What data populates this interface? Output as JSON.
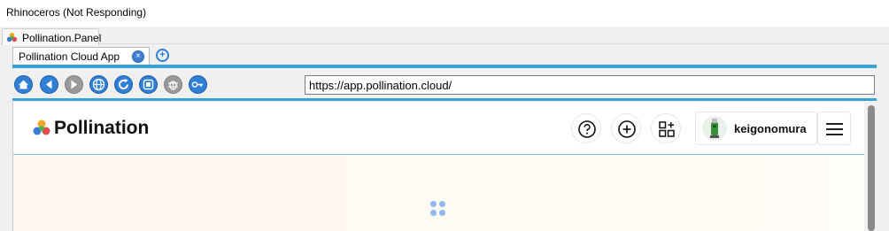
{
  "window": {
    "title": "Rhinoceros (Not Responding)"
  },
  "panel": {
    "tab_label": "Pollination.Panel"
  },
  "doc_tab": {
    "label": "Pollination Cloud App",
    "close_glyph": "⊗",
    "add_glyph": "+"
  },
  "toolbar": {
    "buttons": [
      "home-icon",
      "back-icon",
      "forward-icon",
      "globe-icon",
      "refresh-icon",
      "stop-icon",
      "bug-icon",
      "key-icon"
    ],
    "accent": "#3aa0d8",
    "url": "https://app.pollination.cloud/"
  },
  "app": {
    "brand": "Pollination",
    "help_icon": "question-circle-icon",
    "add_icon": "plus-circle-icon",
    "apps_icon": "grid-plus-icon",
    "username": "keigonomura",
    "menu_icon": "hamburger-menu-icon",
    "loading_icon": "spinner-dots-icon"
  }
}
